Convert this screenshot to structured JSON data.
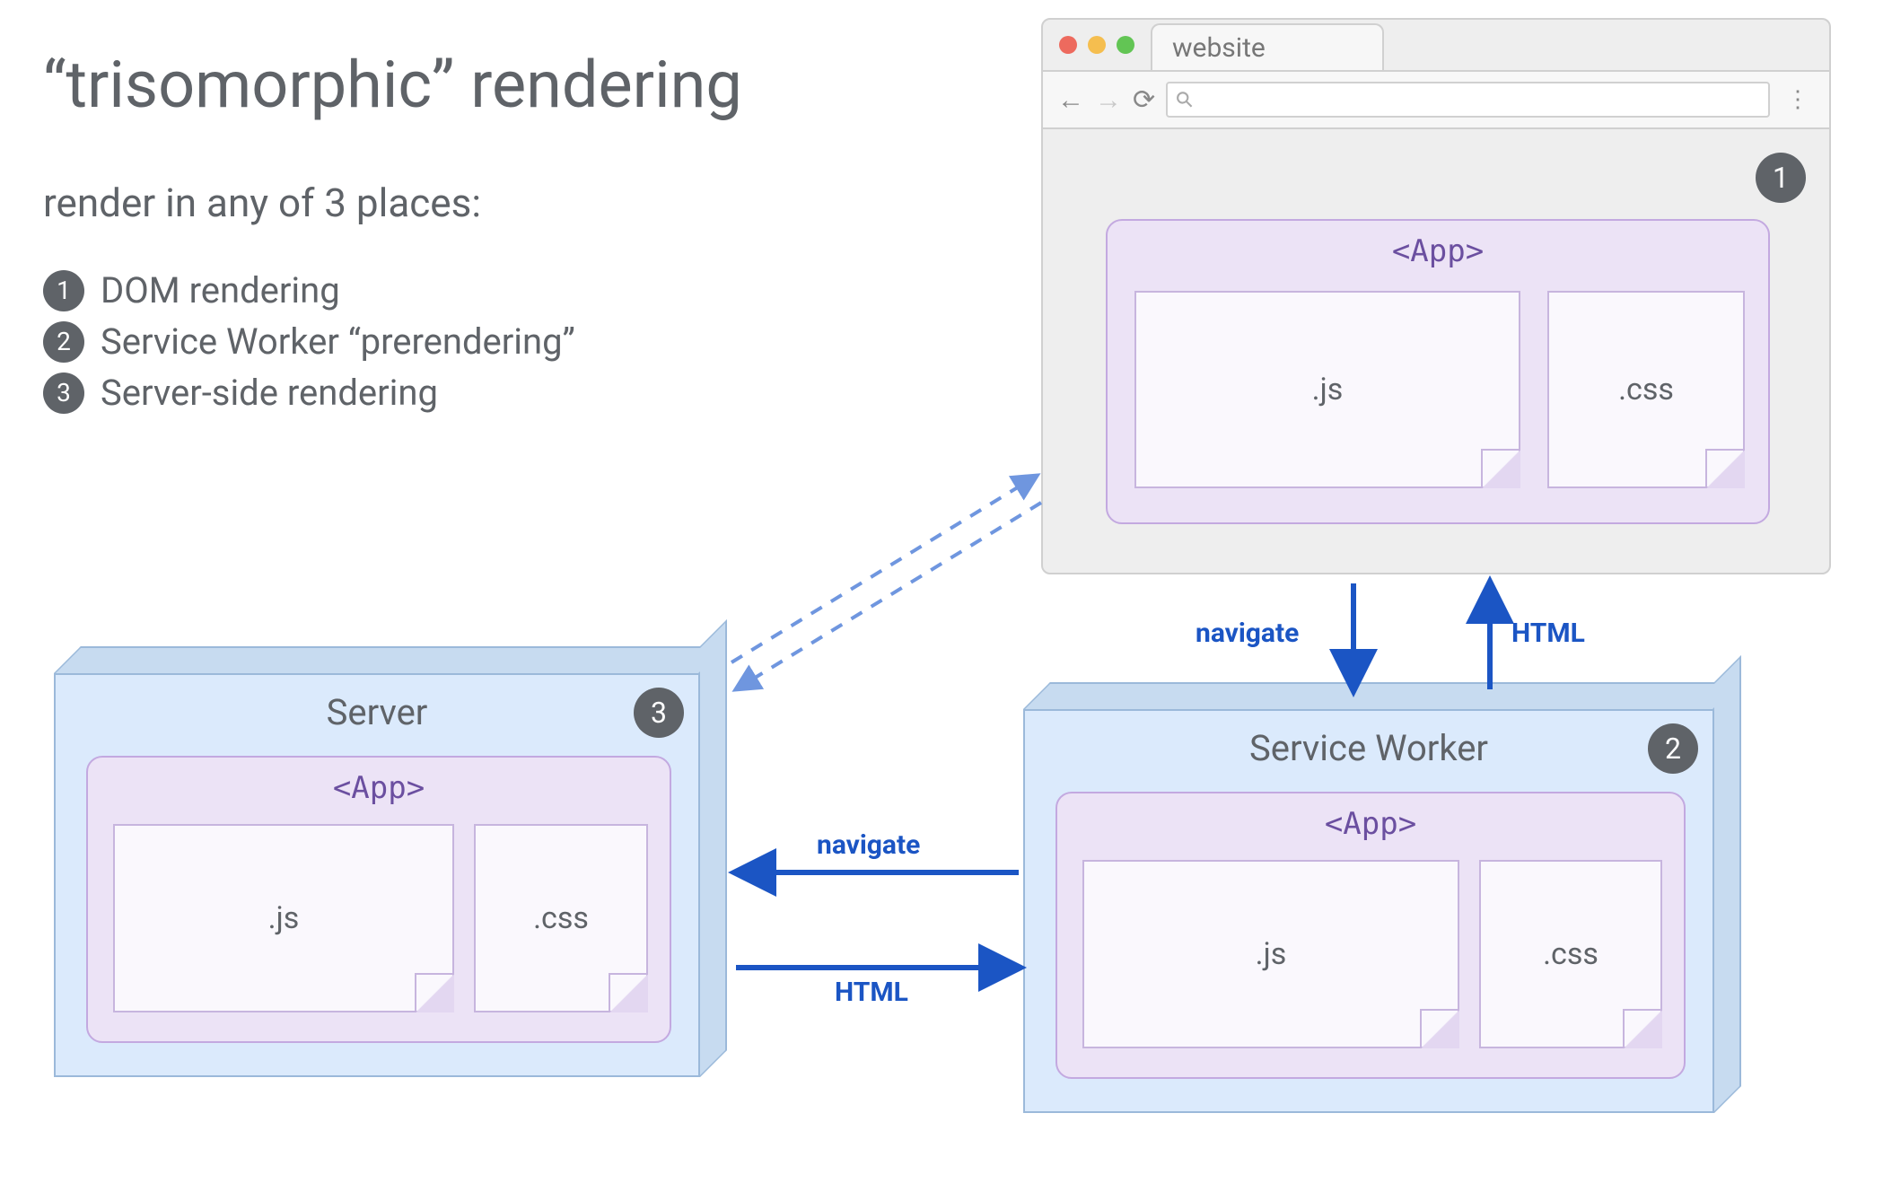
{
  "title": "“trisomorphic” rendering",
  "subtitle": "render in any of 3 places:",
  "bullets": [
    {
      "n": "1",
      "text": "DOM rendering"
    },
    {
      "n": "2",
      "text": "Service Worker “prerendering”"
    },
    {
      "n": "3",
      "text": "Server-side rendering"
    }
  ],
  "browser": {
    "tab_label": "website",
    "search_glyph": "⚲",
    "badge": "1"
  },
  "app_panel": {
    "label": "<App>",
    "js_label": ".js",
    "css_label": ".css"
  },
  "server": {
    "title": "Server",
    "badge": "3"
  },
  "service_worker": {
    "title": "Service Worker",
    "badge": "2"
  },
  "arrows": {
    "browser_to_sw": "navigate",
    "sw_to_browser": "HTML",
    "sw_to_server": "navigate",
    "server_to_sw": "HTML"
  },
  "colors": {
    "text": "#5f6368",
    "badge_bg": "#5f6368",
    "arrow": "#1b55c4",
    "box_fill": "#dbeafc",
    "box_edge": "#9bb9da",
    "app_fill": "#ece3f6",
    "app_edge": "#c3a9e0",
    "app_text": "#6b4fa0"
  }
}
